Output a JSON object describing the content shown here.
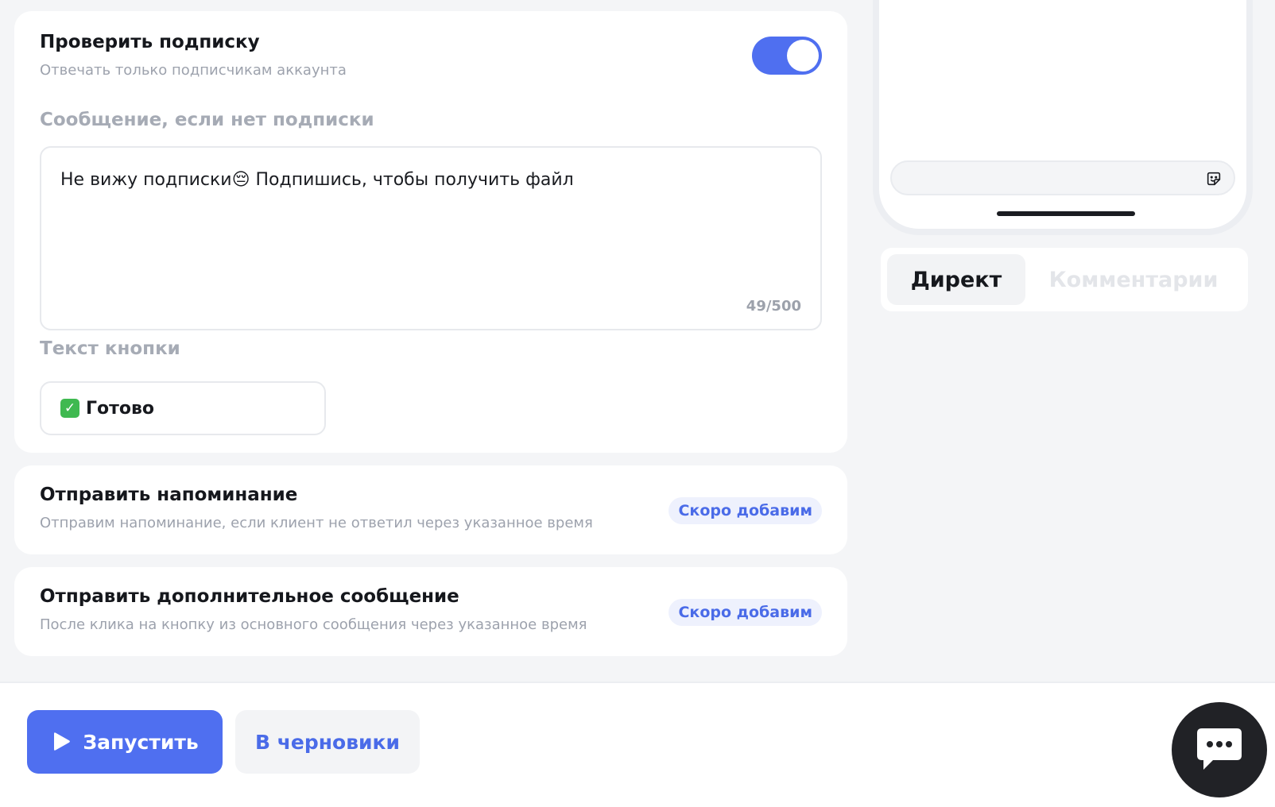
{
  "subscription_check": {
    "title": "Проверить подписку",
    "subtitle": "Отвечать только подписчикам аккаунта",
    "toggle_on": true,
    "message_label": "Сообщение, если нет подписки",
    "message_value": "Не вижу подписки😔 Подпишись, чтобы получить файл",
    "char_counter": "49/500",
    "button_text_label": "Текст кнопки",
    "button_text_value": "Готово"
  },
  "reminder": {
    "title": "Отправить напоминание",
    "subtitle": "Отправим напоминание, если клиент не ответил через указанное время",
    "badge": "Скоро добавим"
  },
  "extra_message": {
    "title": "Отправить дополнительное сообщение",
    "subtitle": "После клика на кнопку из основного сообщения через указанное время",
    "badge": "Скоро добавим"
  },
  "preview": {
    "tabs": [
      {
        "label": "Директ",
        "active": true
      },
      {
        "label": "Комментарии",
        "active": false
      }
    ]
  },
  "actions": {
    "launch_label": "Запустить",
    "draft_label": "В черновики"
  },
  "colors": {
    "accent": "#4f6ff0",
    "badge_bg": "#eef1fd",
    "chat_fab": "#212226"
  },
  "icons": {
    "launch": "play-icon",
    "sticker": "sticker-icon",
    "chat": "chat-bubble-icon"
  }
}
